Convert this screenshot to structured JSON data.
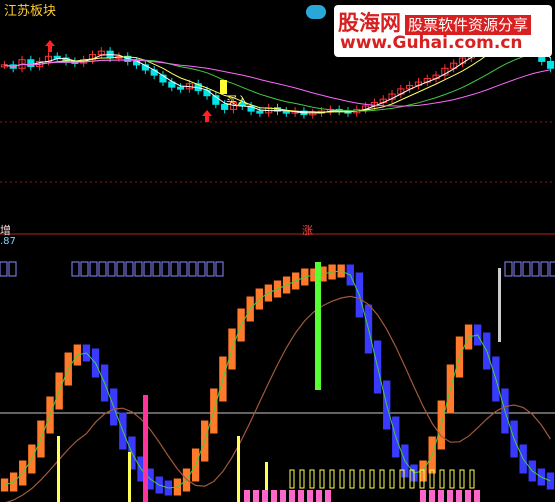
{
  "chart_header": {
    "sector_title": "江苏板块",
    "buy_signal": "买入",
    "lower_left_marker": "增",
    "lower_mid_marker": "涨",
    "indicator_value": ".87"
  },
  "watermark": {
    "logo_text": "股海网",
    "tagline": "股票软件资源分享",
    "url": "www.Guhai.com.cn"
  },
  "colors": {
    "background": "#000000",
    "candle_up": "#ff3333",
    "candle_down": "#00e5e5",
    "ma_short": "#ffffff",
    "ma_mid": "#ffff66",
    "ma_long": "#ff66ff",
    "ma_trend": "#44cc44",
    "ind_blue": "#3a3aff",
    "ind_orange": "#ff7a2a",
    "ind_brown": "#a05a3a",
    "ind_green": "#55ff33",
    "ind_pink": "#ff66cc",
    "ind_yellow": "#ffff55"
  },
  "chart_data": [
    {
      "type": "candlestick",
      "title": "",
      "xlabel": "",
      "ylabel": "",
      "series": [
        {
          "name": "",
          "values": [
            58,
            56,
            61,
            57,
            60,
            63,
            62,
            60,
            59,
            61,
            64,
            66,
            62,
            63,
            60,
            58,
            55,
            52,
            48,
            45,
            44,
            47,
            43,
            40,
            35,
            32,
            36,
            34,
            31,
            30,
            33,
            31,
            30,
            31,
            29,
            30,
            31,
            32,
            31,
            30,
            32,
            34,
            36,
            38,
            41,
            44,
            46,
            48,
            50,
            52,
            56,
            59,
            62,
            66,
            70,
            74,
            78,
            76,
            74,
            72,
            70,
            60,
            56
          ]
        }
      ]
    },
    {
      "type": "bar",
      "title": "",
      "xlabel": "",
      "ylabel": "",
      "series": [
        {
          "name": "",
          "values": [
            5,
            8,
            14,
            22,
            34,
            46,
            58,
            68,
            72,
            70,
            62,
            50,
            38,
            26,
            16,
            10,
            6,
            4,
            3,
            5,
            10,
            20,
            34,
            50,
            66,
            80,
            90,
            96,
            100,
            102,
            104,
            106,
            108,
            110,
            110,
            111,
            112,
            112,
            108,
            92,
            74,
            54,
            36,
            22,
            12,
            10,
            14,
            26,
            44,
            62,
            76,
            82,
            78,
            66,
            50,
            34,
            22,
            14,
            10,
            8,
            6
          ]
        }
      ]
    }
  ]
}
